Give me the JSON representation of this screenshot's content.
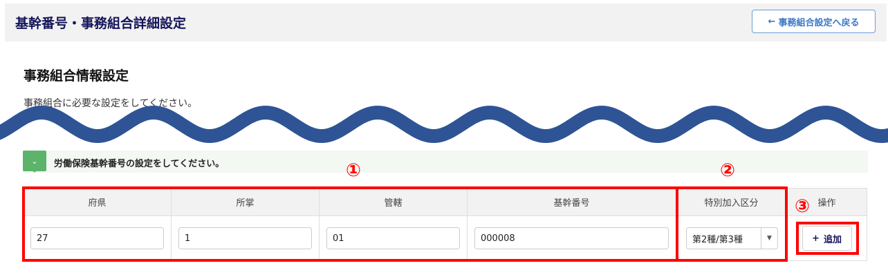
{
  "header": {
    "title": "基幹番号・事務組合詳細設定",
    "back_button": "事務組合設定へ戻る",
    "back_icon": "←"
  },
  "section": {
    "title": "事務組合情報設定",
    "description": "事務組合に必要な設定をしてください。"
  },
  "notice": {
    "text": "労働保険基幹番号の設定をしてください。",
    "icon": "chevron-down"
  },
  "table": {
    "headers": [
      "府県",
      "所掌",
      "管轄",
      "基幹番号",
      "特別加入区分",
      "操作"
    ],
    "row": {
      "prefecture": "27",
      "jurisdiction_type": "1",
      "office": "01",
      "base_number": "000008",
      "special_category": "第2種/第3種",
      "add_button": "追加",
      "add_icon": "+"
    }
  },
  "annotations": [
    "①",
    "②",
    "③"
  ],
  "colors": {
    "title": "#14145a",
    "wave": "#2e5496",
    "highlight": "#ff0000",
    "notice": "#5cb46a"
  }
}
